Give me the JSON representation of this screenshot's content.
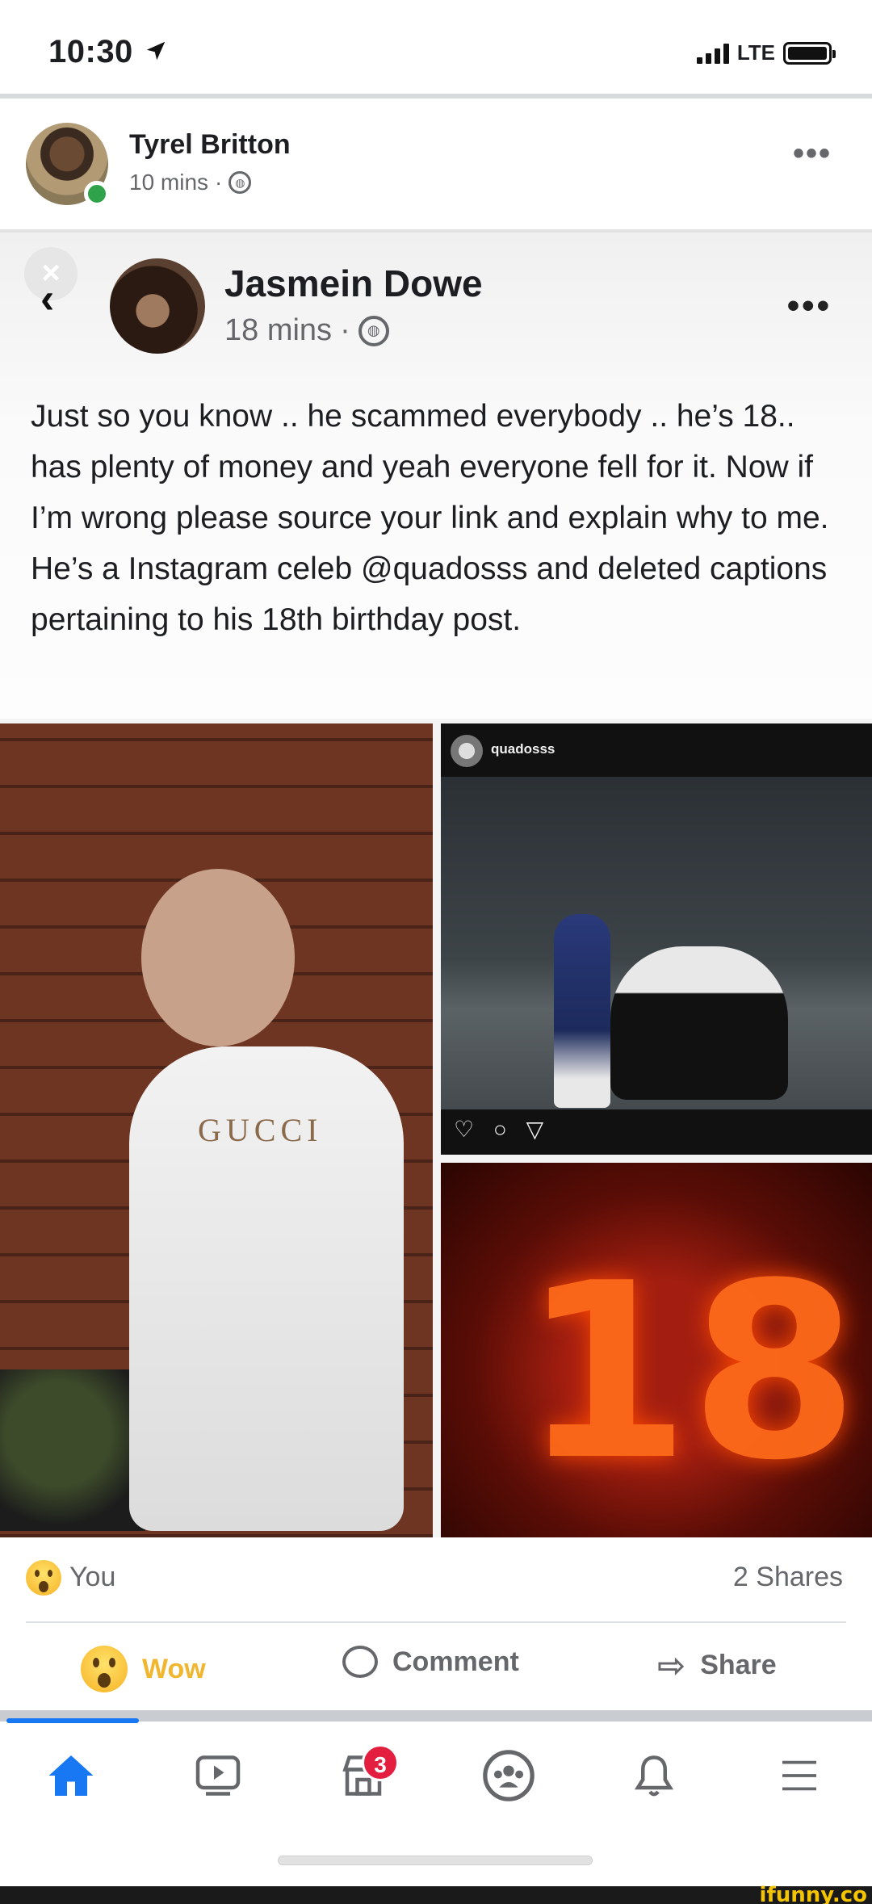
{
  "status_bar": {
    "time": "10:30",
    "network": "LTE"
  },
  "post": {
    "author": "Tyrel Britton",
    "time": "10 mins",
    "privacy_icon": "globe-icon",
    "more_icon": "more-dots-icon"
  },
  "embedded": {
    "author": "Jasmein Dowe",
    "time": "18 mins",
    "text": "Just so you know .. he scammed everybody .. he’s 18.. has plenty of money and yeah everyone fell for it. Now if I’m wrong please source your link and explain why to me. He’s a Instagram celeb @quadosss and deleted captions pertaining to his 18th birthday post.",
    "photo_left_text": "GUCCI",
    "instagram_username": "quadosss",
    "instagram_actions": "♡ ○ ▽",
    "photo_right_bottom_text": "18"
  },
  "reactions": {
    "reactor": "You",
    "shares": "2 Shares"
  },
  "actions": {
    "wow_label": "Wow",
    "comment_label": "Comment",
    "share_label": "Share"
  },
  "nav": {
    "marketplace_badge": "3",
    "items": [
      "home-icon",
      "watch-icon",
      "marketplace-icon",
      "groups-icon",
      "notifications-icon",
      "menu-icon"
    ]
  },
  "watermark": "ifunny.co",
  "colors": {
    "accent": "#1877f2",
    "wow": "#f0b62f",
    "badge": "#e41e3f",
    "online": "#31a24c"
  }
}
